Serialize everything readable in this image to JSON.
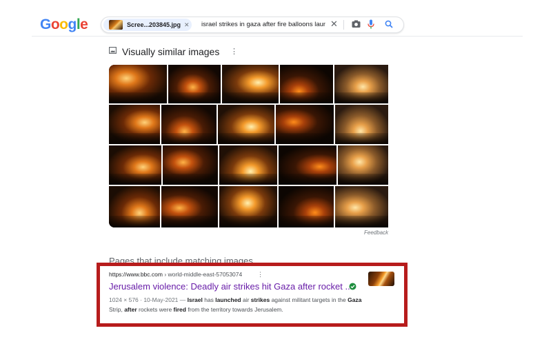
{
  "logo": {
    "letters": [
      "G",
      "o",
      "o",
      "g",
      "l",
      "e"
    ],
    "colors": [
      "#4285f4",
      "#ea4335",
      "#fbbc05",
      "#4285f4",
      "#34a853",
      "#ea4335"
    ]
  },
  "search": {
    "image_chip_label": "Scree...203845.jpg",
    "query": "israel strikes in gaza after fire balloons launche",
    "icons": [
      "close-icon",
      "camera-icon",
      "mic-icon",
      "search-icon"
    ]
  },
  "similar": {
    "title": "Visually similar images",
    "more_label": "⋮",
    "feedback": "Feedback"
  },
  "pages": {
    "title": "Pages that include matching images",
    "result": {
      "url_domain": "https://www.bbc.com",
      "url_path": " › world-middle-east-57053074",
      "more_label": "⋮",
      "title": "Jerusalem violence: Deadly air strikes hit Gaza after rocket ...",
      "meta": "1024 × 576 · 10-May-2021 — ",
      "snippet_parts": [
        {
          "t": "Israel",
          "b": true
        },
        {
          "t": " has ",
          "b": false
        },
        {
          "t": "launched",
          "b": true
        },
        {
          "t": " air ",
          "b": false
        },
        {
          "t": "strikes",
          "b": true
        },
        {
          "t": " against militant targets in the ",
          "b": false
        },
        {
          "t": "Gaza",
          "b": true
        },
        {
          "t": " Strip, ",
          "b": false
        },
        {
          "t": "after",
          "b": true
        },
        {
          "t": " rockets were ",
          "b": false
        },
        {
          "t": "fired",
          "b": true
        },
        {
          "t": " from the territory towards Jerusalem.",
          "b": false
        }
      ]
    }
  },
  "colors": {
    "link_visited": "#681da8",
    "highlight_box": "#b71c1c",
    "verified": "#1e8e3e"
  }
}
